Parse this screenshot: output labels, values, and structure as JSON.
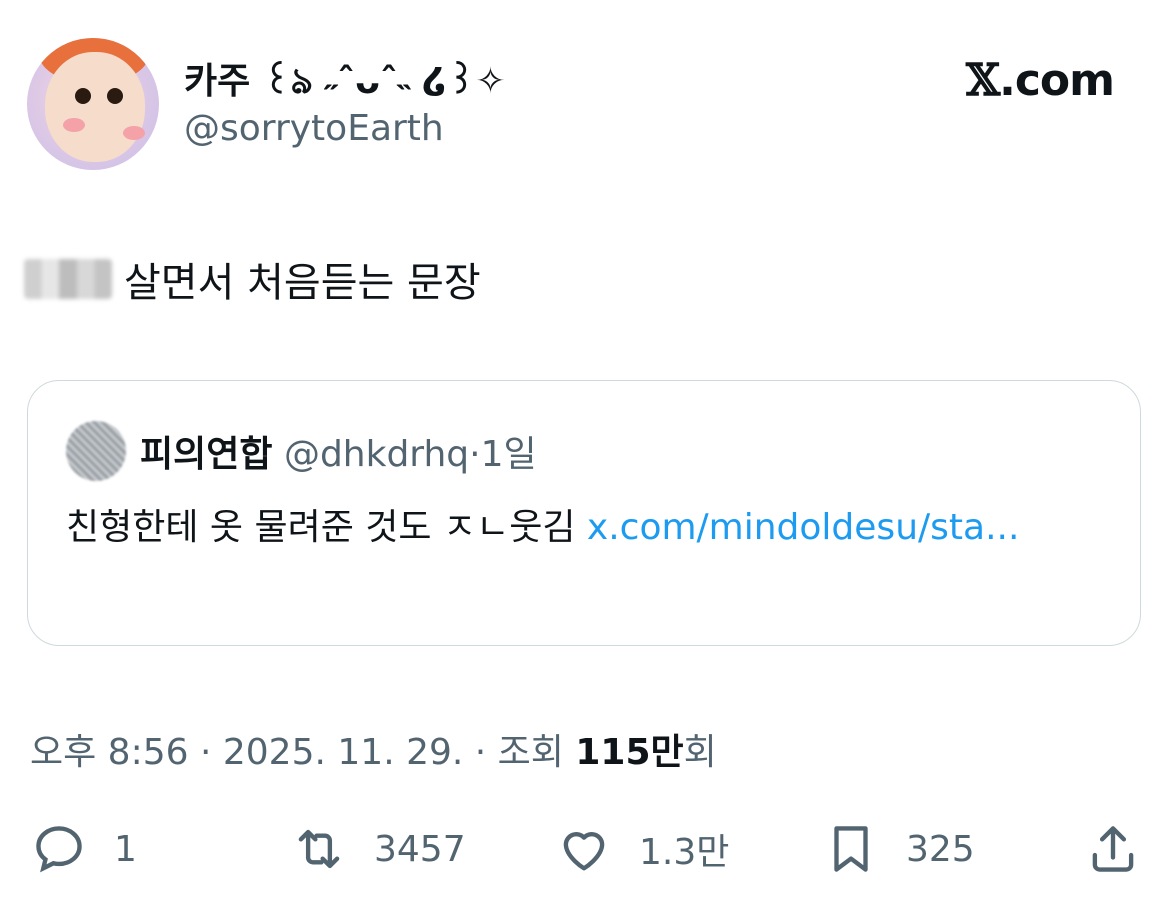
{
  "author": {
    "display_name": "카주 ꒰ঌ ˶ˆᴗˆ˵ ໒꒱✧",
    "handle": "@sorrytoEarth"
  },
  "brand": {
    "logo_text": ".com"
  },
  "tweet": {
    "text": "살면서 처음듣는 문장"
  },
  "quote": {
    "name": "피의연합",
    "handle": "@dhkdrhq",
    "separator": "·",
    "time": "1일",
    "text": "친형한테 옷 물려준 것도 ㅈㄴ웃김 ",
    "link": "x.com/mindoldesu/sta..."
  },
  "meta": {
    "time": "오후 8:56",
    "sep1": " · ",
    "date": "2025. 11. 29.",
    "sep2": " · ",
    "views_label": "조회 ",
    "views_value": "115만",
    "views_suffix": "회"
  },
  "actions": {
    "replies": "1",
    "reposts": "3457",
    "likes": "1.3만",
    "bookmarks": "325"
  },
  "colors": {
    "link": "#1d9bf0",
    "muted": "#536471",
    "text": "#0f1419",
    "border": "#cfd9de"
  }
}
